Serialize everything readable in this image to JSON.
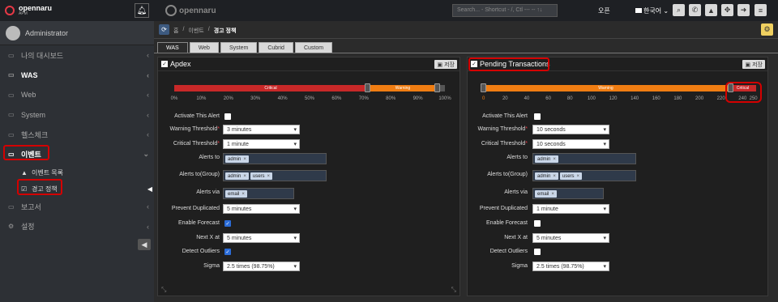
{
  "brand": {
    "name": "opennaru",
    "sub": "APM"
  },
  "user": {
    "name": "Administrator"
  },
  "sidebar": {
    "items": [
      {
        "label": "나의 대시보드",
        "icon": "folder-icon"
      },
      {
        "label": "WAS",
        "icon": "folder-icon"
      },
      {
        "label": "Web",
        "icon": "folder-icon"
      },
      {
        "label": "System",
        "icon": "folder-icon"
      },
      {
        "label": "헬스체크",
        "icon": "folder-icon"
      },
      {
        "label": "이벤트",
        "icon": "folder-open-icon"
      }
    ],
    "subitems": [
      {
        "label": "이벤트 목록",
        "icon": "bell-icon"
      },
      {
        "label": "경고 정책",
        "icon": "checkbox-icon"
      }
    ],
    "items2": [
      {
        "label": "보고서",
        "icon": "folder-icon"
      },
      {
        "label": "설정",
        "icon": "gears-icon"
      }
    ]
  },
  "topbar": {
    "logo": "opennaru",
    "search_placeholder": "Search... - Shortcut - /, Ctl --- -- ↑↓",
    "status": "오픈",
    "language": "한국어"
  },
  "breadcrumb": {
    "home": "홈",
    "sep": "/",
    "level1": "이벤트",
    "current": "경고 정책"
  },
  "tabs": [
    "WAS",
    "Web",
    "System",
    "Cubrid",
    "Custom"
  ],
  "panels": [
    {
      "title": "Apdex",
      "save_label": "저장",
      "slider": {
        "critical_label": "Critical",
        "warning_label": "Warning",
        "ticks": [
          "0%",
          "10%",
          "20%",
          "30%",
          "40%",
          "50%",
          "60%",
          "70%",
          "80%",
          "90%",
          "100%"
        ]
      },
      "form": {
        "activate_label": "Activate This Alert",
        "warning_label": "Warning Threshold",
        "warning_value": "3 minutes",
        "critical_label": "Critical Threshold",
        "critical_value": "1 minute",
        "alerts_to_label": "Alerts to",
        "alerts_to": [
          "admin"
        ],
        "alerts_group_label": "Alerts to(Group)",
        "alerts_group": [
          "admin",
          "users"
        ],
        "alerts_via_label": "Alerts via",
        "alerts_via": [
          "email"
        ],
        "prevent_label": "Prevent Duplicated",
        "prevent_value": "5 minutes",
        "forecast_label": "Enable Forecast",
        "next_label": "Next X at",
        "next_value": "5 minutes",
        "outliers_label": "Detect Outliers",
        "sigma_label": "Sigma",
        "sigma_value": "2.5 times (98.75%)"
      }
    },
    {
      "title": "Pending Transactions",
      "save_label": "저장",
      "slider": {
        "critical_label": "Critical",
        "warning_label": "Warning",
        "ticks": [
          "0",
          "20",
          "40",
          "60",
          "80",
          "100",
          "120",
          "140",
          "160",
          "180",
          "200",
          "220",
          "240",
          "250"
        ]
      },
      "form": {
        "activate_label": "Activate This Alert",
        "warning_label": "Warning Threshold",
        "warning_value": "10 seconds",
        "critical_label": "Critical Threshold",
        "critical_value": "10 seconds",
        "alerts_to_label": "Alerts to",
        "alerts_to": [
          "admin"
        ],
        "alerts_group_label": "Alerts to(Group)",
        "alerts_group": [
          "admin",
          "users"
        ],
        "alerts_via_label": "Alerts via",
        "alerts_via": [
          "email"
        ],
        "prevent_label": "Prevent Duplicated",
        "prevent_value": "1 minute",
        "forecast_label": "Enable Forecast",
        "next_label": "Next X at",
        "next_value": "5 minutes",
        "outliers_label": "Detect Outliers",
        "sigma_label": "Sigma",
        "sigma_value": "2.5 times (98.75%)"
      }
    }
  ]
}
